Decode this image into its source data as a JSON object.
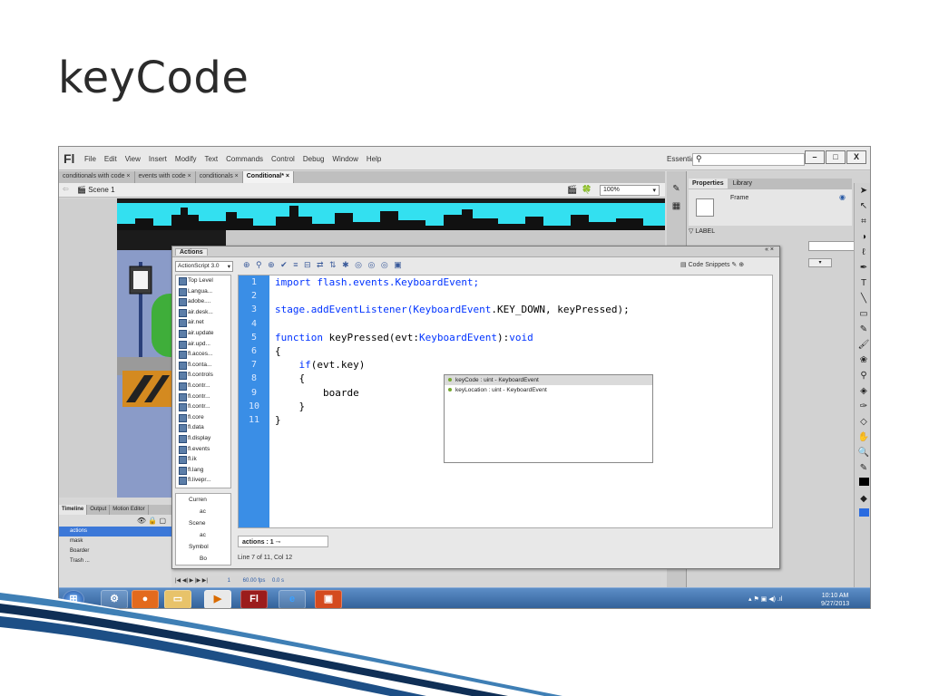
{
  "slide": {
    "title": "keyCode"
  },
  "app": {
    "logo": "Fl",
    "menus": [
      "File",
      "Edit",
      "View",
      "Insert",
      "Modify",
      "Text",
      "Commands",
      "Control",
      "Debug",
      "Window",
      "Help"
    ],
    "workspace": "Essentials",
    "window_buttons": [
      "–",
      "□",
      "X"
    ]
  },
  "doc_tabs": [
    {
      "label": "conditionals with code ×",
      "active": false
    },
    {
      "label": "events with code ×",
      "active": false
    },
    {
      "label": "conditionals ×",
      "active": false
    },
    {
      "label": "Conditional* ×",
      "active": true
    }
  ],
  "scene": {
    "label": "Scene 1",
    "zoom": "100%"
  },
  "properties": {
    "tabs": [
      "Properties",
      "Library"
    ],
    "frame_label": "Frame",
    "section": "LABEL"
  },
  "actions_panel": {
    "title": "Actions",
    "language": "ActionScript 3.0",
    "code_snippets": "Code Snippets",
    "library_items": [
      "Top Level",
      "Langua...",
      "adobe....",
      "air.desk...",
      "air.net",
      "air.update",
      "air.upd...",
      "fl.acces...",
      "fl.conta...",
      "fl.controls",
      "fl.contr...",
      "fl.contr...",
      "fl.contr...",
      "fl.core",
      "fl.data",
      "fl.display",
      "fl.events",
      "fl.ik",
      "fl.lang",
      "fl.livepr..."
    ],
    "script_nav": [
      "Curren",
      "ac",
      "Scene",
      "ac",
      "Symbol",
      "Bo"
    ],
    "line_numbers": [
      "1",
      "2",
      "3",
      "4",
      "5",
      "6",
      "7",
      "8",
      "9",
      "10",
      "11"
    ],
    "code": {
      "l1a": "import",
      "l1b": " flash.events.KeyboardEvent;",
      "l3a": "stage.addEventListener(",
      "l3b": "KeyboardEvent",
      "l3c": ".KEY_DOWN, keyPressed);",
      "l5a": "function",
      "l5b": " keyPressed(evt:",
      "l5c": "KeyboardEvent",
      "l5d": "):",
      "l5e": "void",
      "l6": "{",
      "l7a": "    ",
      "l7b": "if",
      "l7c": "(evt.key)",
      "l8": "    {",
      "l9": "        boarde",
      "l10": "    }",
      "l11": "}"
    },
    "autocomplete": [
      "keyCode : uint - KeyboardEvent",
      "keyLocation : uint - KeyboardEvent"
    ],
    "script_tab": "actions : 1",
    "status": "Line 7 of 11, Col 12"
  },
  "timeline": {
    "tabs": [
      "Timeline",
      "Output",
      "Motion Editor"
    ],
    "layers": [
      "actions",
      "mask",
      "Boarder",
      "Trash ..."
    ],
    "fps": "60.00 fps",
    "time": "0.0 s",
    "frame": "1"
  },
  "taskbar": {
    "time": "10:10 AM",
    "date": "9/27/2013"
  }
}
